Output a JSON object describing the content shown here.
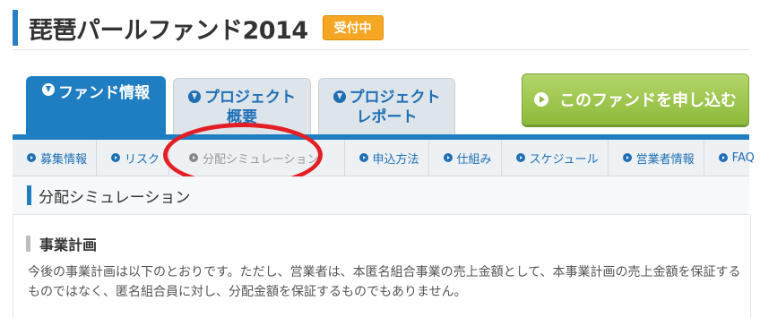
{
  "header": {
    "title": "琵琶パールファンド2014",
    "status_badge": "受付中"
  },
  "tabs": [
    {
      "label": "ファンド情報",
      "active": true,
      "icon": "download-circle-icon"
    },
    {
      "label_line1": "プロジェクト",
      "label_line2": "概要",
      "active": false,
      "icon": "download-circle-icon"
    },
    {
      "label_line1": "プロジェクト",
      "label_line2": "レポート",
      "active": false,
      "icon": "download-circle-icon"
    }
  ],
  "apply_button": {
    "label": "このファンドを申し込む",
    "icon": "arrow-right-circle-icon"
  },
  "subnav": [
    {
      "label": "募集情報"
    },
    {
      "label": "リスク"
    },
    {
      "label": "分配シミュレーション",
      "current": true
    },
    {
      "label": "申込方法"
    },
    {
      "label": "仕組み"
    },
    {
      "label": "スケジュール"
    },
    {
      "label": "営業者情報"
    },
    {
      "label": "FAQ"
    }
  ],
  "section": {
    "title": "分配シミュレーション"
  },
  "content": {
    "subheading": "事業計画",
    "body": "今後の事業計画は以下のとおりです。ただし、営業者は、本匿名組合事業の売上金額として、本事業計画の売上金額を保証するものではなく、匿名組合員に対し、分配金額を保証するものでもありません。"
  },
  "colors": {
    "brand_blue": "#1f7ec2",
    "badge_orange": "#f5a623",
    "apply_green": "#8dba3a",
    "annotation_red": "#e31e24"
  }
}
